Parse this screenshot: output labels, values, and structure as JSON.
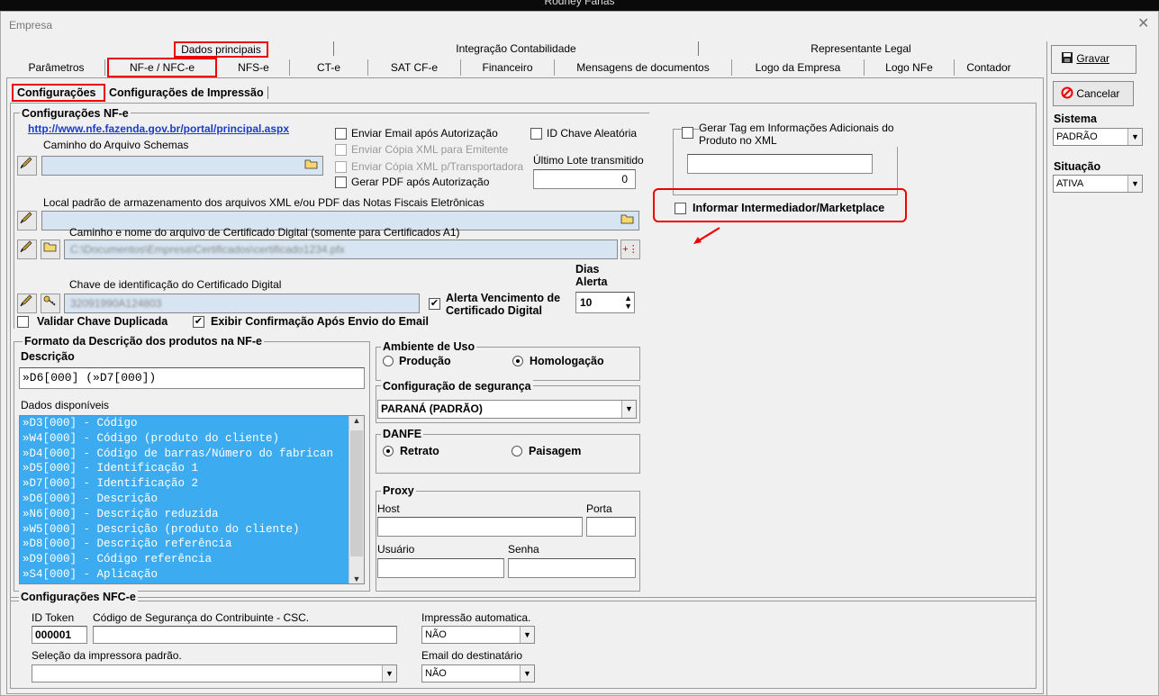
{
  "topbar": {
    "title": "Rodney Farias"
  },
  "window": {
    "title": "Empresa",
    "close": "✕"
  },
  "tabs_row1": [
    {
      "label": "Dados principais"
    },
    {
      "label": "Integração Contabilidade"
    },
    {
      "label": "Representante Legal"
    }
  ],
  "tabs_row2": [
    {
      "label": "Parâmetros"
    },
    {
      "label": "NF-e / NFC-e"
    },
    {
      "label": "NFS-e"
    },
    {
      "label": "CT-e"
    },
    {
      "label": "SAT CF-e"
    },
    {
      "label": "Financeiro"
    },
    {
      "label": "Mensagens de documentos"
    },
    {
      "label": "Logo da Empresa"
    },
    {
      "label": "Logo NFe"
    },
    {
      "label": "Contador"
    }
  ],
  "subtabs": [
    {
      "label": "Configurações"
    },
    {
      "label": "Configurações de Impressão"
    }
  ],
  "nfe": {
    "group_title": "Configurações NF-e",
    "schema_url": "http://www.nfe.fazenda.gov.br/portal/principal.aspx",
    "schema_label": "Caminho do Arquivo Schemas",
    "schema_value": "",
    "xml_label": "Local padrão de armazenamento dos arquivos XML e/ou PDF das Notas Fiscais Eletrônicas",
    "xml_value": "",
    "cert_label": "Caminho e nome do arquivo de Certificado Digital (somente para Certificados A1)",
    "cert_value": "C:\\Documentos\\Empresa\\Certificados\\certificado1234.pfx",
    "key_label": "Chave de identificação do Certificado Digital",
    "key_value": "32091990A124803",
    "chk_email": "Enviar Email após Autorização",
    "chk_copy_emit": "Enviar Cópia XML para Emitente",
    "chk_copy_transp": "Enviar Cópia XML p/Transportadora",
    "chk_pdf": "Gerar PDF após Autorização",
    "chk_random": "ID Chave Aleatória",
    "last_lot_label": "Último Lote transmitido",
    "last_lot_value": "0",
    "chk_alert": "Alerta Vencimento de Certificado Digital",
    "days_label": "Dias Alerta",
    "days_value": "10",
    "chk_dup": "Validar Chave Duplicada",
    "chk_confirm": "Exibir Confirmação Após Envio do Email",
    "tag_label": "Gerar Tag em Informações Adicionais do Produto no XML",
    "tag_value": "",
    "chk_intermed": "Informar Intermediador/Marketplace"
  },
  "formato": {
    "title": "Formato da Descrição dos produtos na NF-e",
    "desc_label": "Descrição",
    "desc_value": "»D6[000] (»D7[000])",
    "dados_label": "Dados disponíveis",
    "items": [
      "»D3[000] - Código",
      "»W4[000] - Código (produto do cliente)",
      "»D4[000] - Código de barras/Número do fabrican",
      "»D5[000] - Identificação 1",
      "»D7[000] - Identificação 2",
      "»D6[000] - Descrição",
      "»N6[000] - Descrição reduzida",
      "»W5[000] - Descrição (produto do cliente)",
      "»D8[000] - Descrição referência",
      "»D9[000] - Código referência",
      "»S4[000] - Aplicação"
    ]
  },
  "ambiente": {
    "title": "Ambiente de Uso",
    "opt1": "Produção",
    "opt2": "Homologação"
  },
  "seguranca": {
    "title": "Configuração de segurança",
    "value": "PARANÁ (PADRÃO)"
  },
  "danfe": {
    "title": "DANFE",
    "opt1": "Retrato",
    "opt2": "Paisagem"
  },
  "proxy": {
    "title": "Proxy",
    "host": "Host",
    "porta": "Porta",
    "usuario": "Usuário",
    "senha": "Senha"
  },
  "nfce": {
    "title": "Configurações NFC-e",
    "id_token_label": "ID Token",
    "id_token_value": "000001",
    "csc_label": "Código de Segurança do Contribuinte - CSC.",
    "csc_value": "",
    "impressora_label": "Seleção da impressora padrão.",
    "impressora_value": "",
    "impressao_label": "Impressão automatica.",
    "impressao_value": "NÃO",
    "email_label": "Email do destinatário",
    "email_value": "NÃO"
  },
  "side": {
    "gravar": "Gravar",
    "cancelar": "Cancelar",
    "sistema_label": "Sistema",
    "sistema_value": "PADRÃO",
    "situacao_label": "Situação",
    "situacao_value": "ATIVA"
  },
  "colors": {
    "accent_red": "#e00000",
    "list_blue": "#3dabf0",
    "link_blue": "#1a3cc9"
  }
}
